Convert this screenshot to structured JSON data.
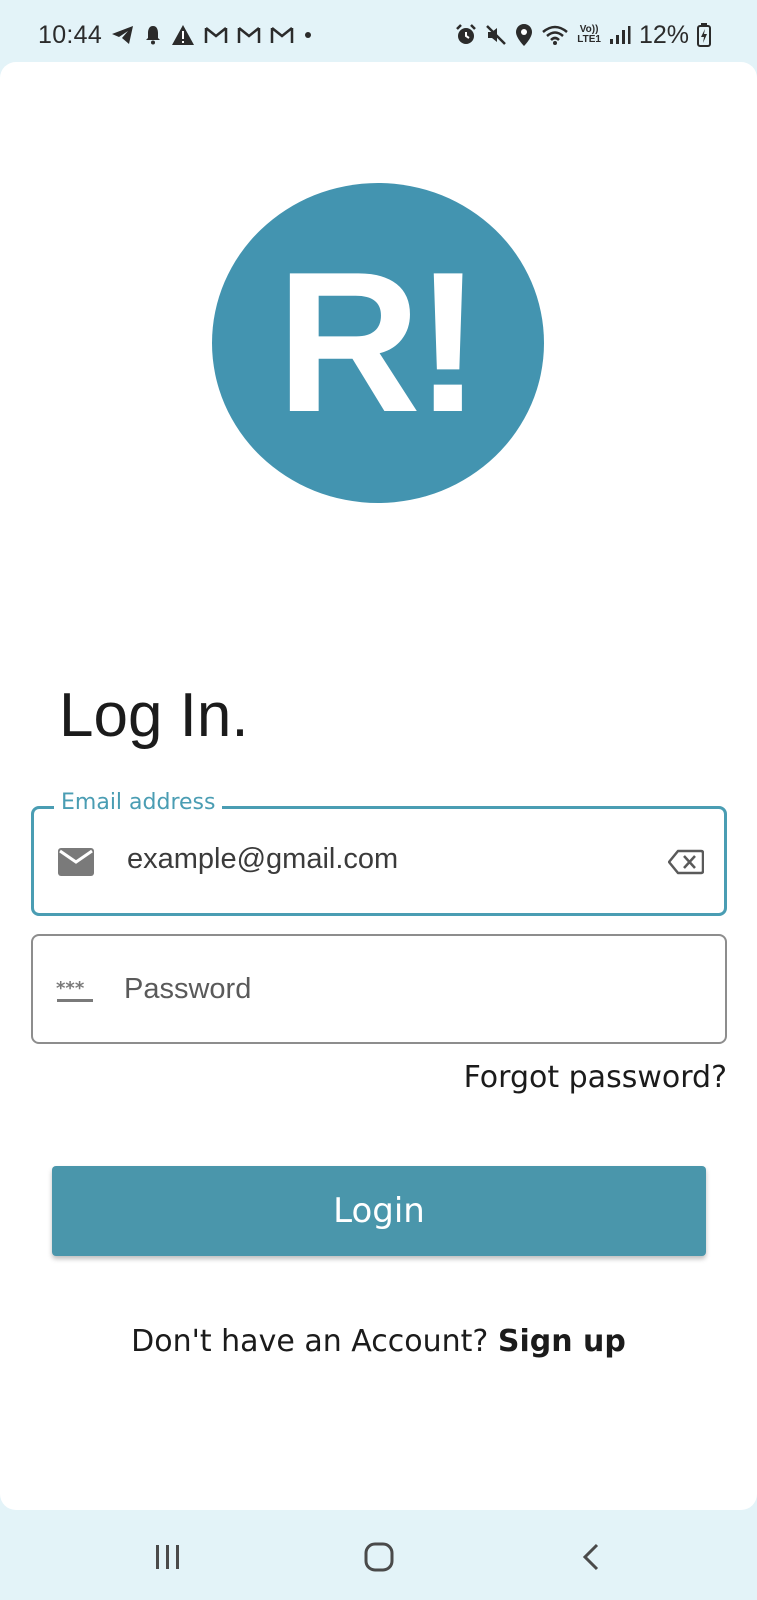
{
  "status_bar": {
    "time": "10:44",
    "battery": "12%",
    "network_label_top": "Vo))",
    "network_label_bottom": "LTE1"
  },
  "logo": {
    "text": "R!",
    "color": "#4394b0"
  },
  "page_title": "Log In.",
  "email": {
    "label": "Email address",
    "value": "example@gmail.com",
    "accent_color": "#4a9db3"
  },
  "password": {
    "placeholder": "Password"
  },
  "forgot_password": "Forgot password?",
  "login_button": "Login",
  "signup": {
    "prompt": "Don't have an Account? ",
    "link": "Sign up"
  },
  "colors": {
    "button": "#4a96ab",
    "bar_background": "#e3f3f8"
  }
}
